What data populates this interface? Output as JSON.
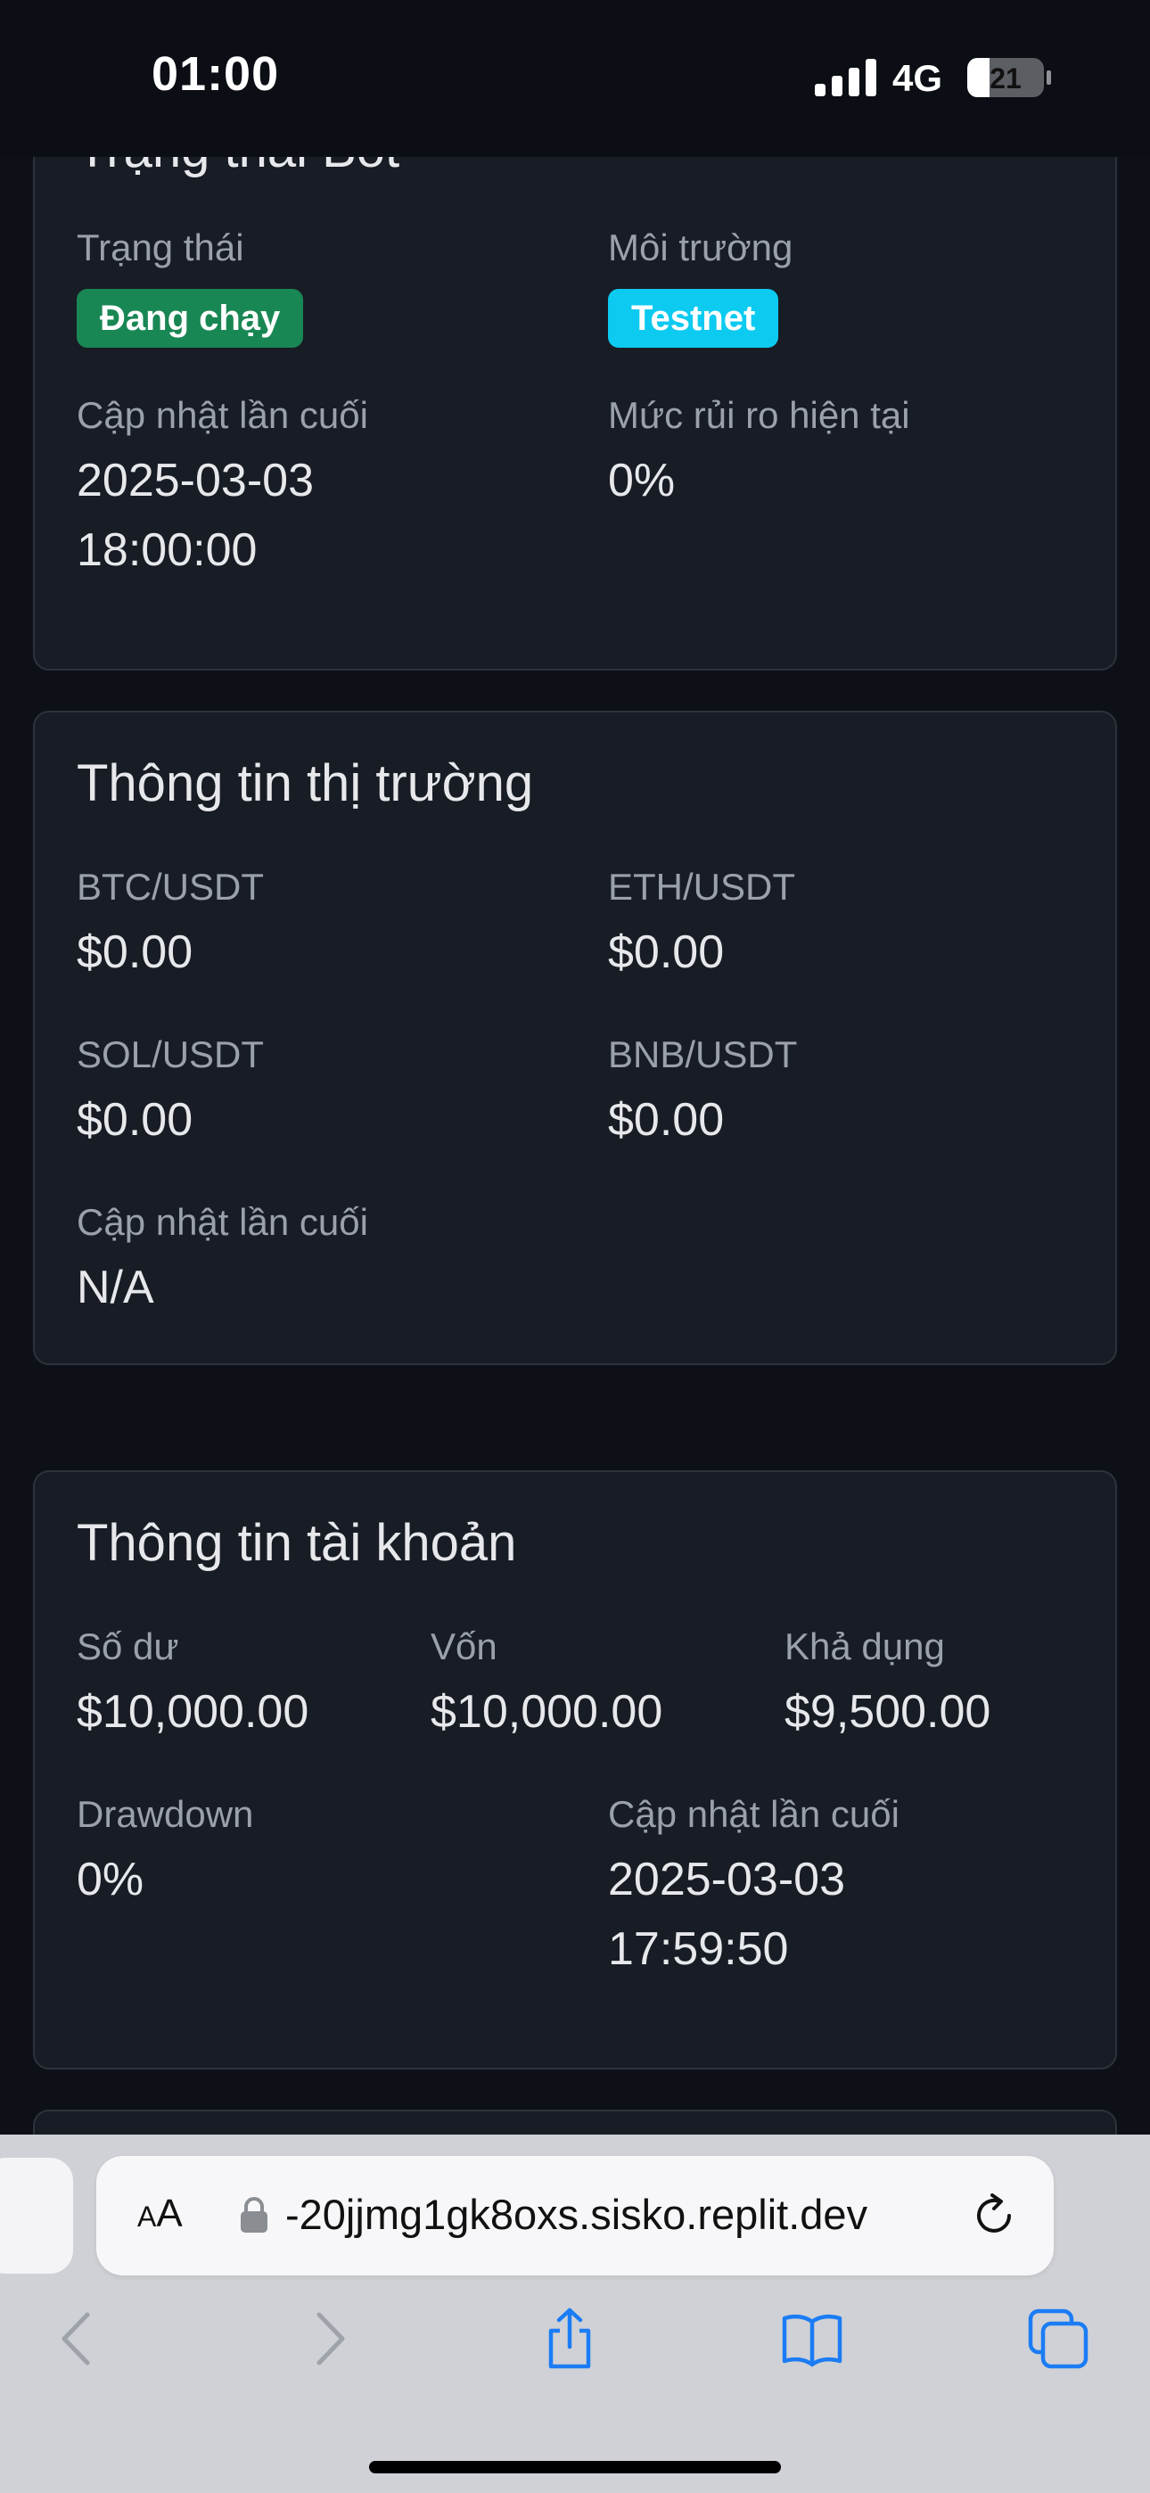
{
  "status_bar": {
    "time": "01:00",
    "network": "4G",
    "battery": "21"
  },
  "bot_status": {
    "title": "Trạng thái Bot",
    "status_label": "Trạng thái",
    "status_badge": "Đang chạy",
    "environment_label": "Môi trường",
    "environment_badge": "Testnet",
    "last_update_label": "Cập nhật lần cuối",
    "last_update_date": "2025-03-03",
    "last_update_time": "18:00:00",
    "risk_label": "Mức rủi ro hiện tại",
    "risk_value": "0%"
  },
  "market": {
    "title": "Thông tin thị trường",
    "pairs": [
      {
        "symbol": "BTC/USDT",
        "price": "$0.00"
      },
      {
        "symbol": "ETH/USDT",
        "price": "$0.00"
      },
      {
        "symbol": "SOL/USDT",
        "price": "$0.00"
      },
      {
        "symbol": "BNB/USDT",
        "price": "$0.00"
      }
    ],
    "last_update_label": "Cập nhật lần cuối",
    "last_update_value": "N/A"
  },
  "account": {
    "title": "Thông tin tài khoản",
    "balance_label": "Số dư",
    "balance_value": "$10,000.00",
    "equity_label": "Vốn",
    "equity_value": "$10,000.00",
    "available_label": "Khả dụng",
    "available_value": "$9,500.00",
    "drawdown_label": "Drawdown",
    "drawdown_value": "0%",
    "last_update_label": "Cập nhật lần cuối",
    "last_update_date": "2025-03-03",
    "last_update_time": "17:59:50"
  },
  "browser": {
    "aa_label_small": "A",
    "aa_label_large": "A",
    "url": "-20jjmg1gk8oxs.sisko.replit.dev"
  },
  "colors": {
    "page_background": "#0d1017",
    "card_background": "#181c24",
    "badge_running": "#198754",
    "badge_testnet": "#0dcaf0",
    "toolbar_accent": "#1b7cf5"
  }
}
